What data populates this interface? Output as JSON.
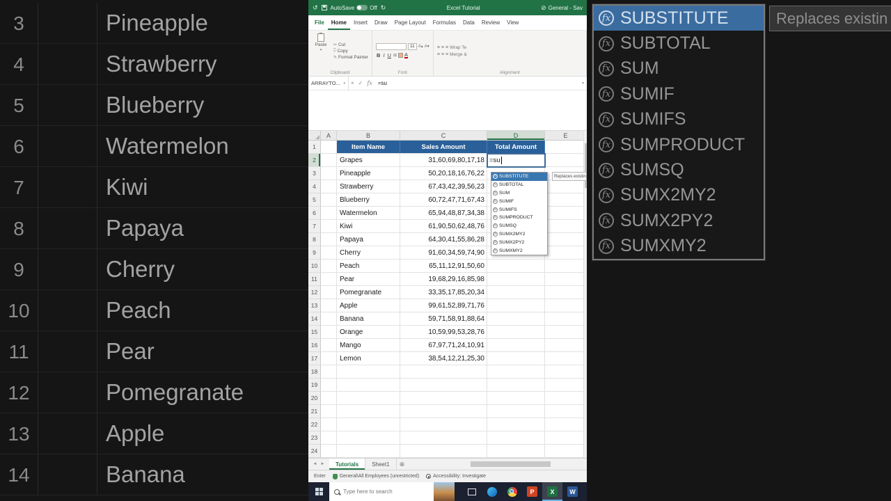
{
  "colors": {
    "excel_green": "#217346",
    "header_blue": "#2a6099",
    "taskbar_bg": "#1b2130",
    "selected_function_bg": "#3a6ca0"
  },
  "left_panel": {
    "rows": [
      {
        "num": "3",
        "name": "Pineapple"
      },
      {
        "num": "4",
        "name": "Strawberry"
      },
      {
        "num": "5",
        "name": "Blueberry"
      },
      {
        "num": "6",
        "name": "Watermelon"
      },
      {
        "num": "7",
        "name": "Kiwi"
      },
      {
        "num": "8",
        "name": "Papaya"
      },
      {
        "num": "9",
        "name": "Cherry"
      },
      {
        "num": "10",
        "name": "Peach"
      },
      {
        "num": "11",
        "name": "Pear"
      },
      {
        "num": "12",
        "name": "Pomegranate"
      },
      {
        "num": "13",
        "name": "Apple"
      },
      {
        "num": "14",
        "name": "Banana"
      }
    ]
  },
  "right_panel": {
    "functions": [
      "SUBSTITUTE",
      "SUBTOTAL",
      "SUM",
      "SUMIF",
      "SUMIFS",
      "SUMPRODUCT",
      "SUMSQ",
      "SUMX2MY2",
      "SUMX2PY2",
      "SUMXMY2"
    ],
    "selected_function": "SUBSTITUTE",
    "fx_glyph": "fx",
    "tooltip": "Replaces existin"
  },
  "excel": {
    "title_bar": {
      "autosave_label": "AutoSave",
      "autosave_state": "Off",
      "title": "Excel Tutorial",
      "sensitivity_label": "General - Sav"
    },
    "ribbon_tabs": [
      "File",
      "Home",
      "Insert",
      "Draw",
      "Page Layout",
      "Formulas",
      "Data",
      "Review",
      "View"
    ],
    "active_tab": "Home",
    "ribbon": {
      "clipboard": {
        "label": "Clipboard",
        "paste": "Paste",
        "cut": "Cut",
        "copy": "Copy",
        "format_painter": "Format Painter"
      },
      "font": {
        "label": "Font",
        "size": "11",
        "bold": "B",
        "italic": "I",
        "underline": "U"
      },
      "alignment": {
        "label": "Alignment",
        "wrap_text": "Wrap Te",
        "merge": "Merge &"
      }
    },
    "formula_bar": {
      "name_box": "ARRAYTO...",
      "formula": "=su"
    },
    "grid": {
      "column_headers": [
        "A",
        "B",
        "C",
        "D",
        "E"
      ],
      "total_rows": 24,
      "header_row": {
        "b": "Item Name",
        "c": "Sales Amount",
        "d": "Total Amount"
      },
      "editing": {
        "cell": "D2",
        "text": "=su"
      },
      "rows": [
        {
          "name": "Grapes",
          "sales": "31,60,69,80,17,18"
        },
        {
          "name": "Pineapple",
          "sales": "50,20,18,16,76,22"
        },
        {
          "name": "Strawberry",
          "sales": "67,43,42,39,56,23"
        },
        {
          "name": "Blueberry",
          "sales": "60,72,47,71,67,43"
        },
        {
          "name": "Watermelon",
          "sales": "65,94,48,87,34,38"
        },
        {
          "name": "Kiwi",
          "sales": "61,90,50,62,48,76"
        },
        {
          "name": "Papaya",
          "sales": "64,30,41,55,86,28"
        },
        {
          "name": "Cherry",
          "sales": "91,60,34,59,74,90"
        },
        {
          "name": "Peach",
          "sales": "65,11,12,91,50,60"
        },
        {
          "name": "Pear",
          "sales": "19,68,29,16,85,98"
        },
        {
          "name": "Pomegranate",
          "sales": "33,35,17,85,20,34"
        },
        {
          "name": "Apple",
          "sales": "99,61,52,89,71,76"
        },
        {
          "name": "Banana",
          "sales": "59,71,58,91,88,64"
        },
        {
          "name": "Orange",
          "sales": "10,59,99,53,28,76"
        },
        {
          "name": "Mango",
          "sales": "67,97,71,24,10,91"
        },
        {
          "name": "Lemon",
          "sales": "38,54,12,21,25,30"
        }
      ]
    },
    "autocomplete": {
      "items": [
        "SUBSTITUTE",
        "SUBTOTAL",
        "SUM",
        "SUMIF",
        "SUMIFS",
        "SUMPRODUCT",
        "SUMSQ",
        "SUMX2MY2",
        "SUMX2PY2",
        "SUMXMY2"
      ],
      "selected": "SUBSTITUTE",
      "tooltip": "Replaces existin"
    },
    "sheet_tabs": {
      "tabs": [
        "Tutorials",
        "Sheet1"
      ],
      "active": "Tutorials"
    },
    "status_bar": {
      "mode": "Enter",
      "sensitivity": "General\\All Employees (unrestricted)",
      "accessibility": "Accessibility: Investigate"
    },
    "taskbar": {
      "search_placeholder": "Type here to search",
      "icons": {
        "powerpoint": "P",
        "excel": "X",
        "word": "W"
      }
    }
  }
}
